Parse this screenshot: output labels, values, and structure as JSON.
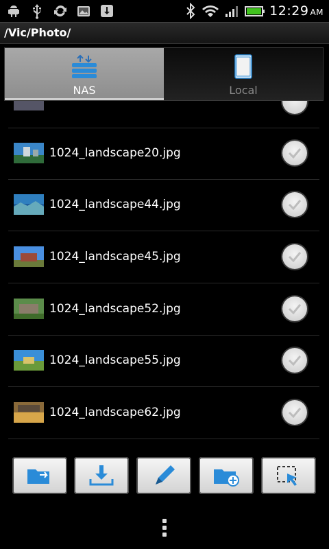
{
  "status": {
    "time": "12:29",
    "ampm": "AM"
  },
  "path": "/Vic/Photo/",
  "tabs": [
    {
      "label": "NAS",
      "active": true
    },
    {
      "label": "Local",
      "active": false
    }
  ],
  "files": [
    {
      "name": "1024_landscape20.jpg"
    },
    {
      "name": "1024_landscape44.jpg"
    },
    {
      "name": "1024_landscape45.jpg"
    },
    {
      "name": "1024_landscape52.jpg"
    },
    {
      "name": "1024_landscape55.jpg"
    },
    {
      "name": "1024_landscape62.jpg"
    }
  ],
  "toolbar": [
    "folder-arrow-icon",
    "download-icon",
    "pen-icon",
    "new-folder-icon",
    "select-icon"
  ],
  "colors": {
    "accent": "#2a8bd8",
    "tab_active": "#9a9a9a"
  }
}
